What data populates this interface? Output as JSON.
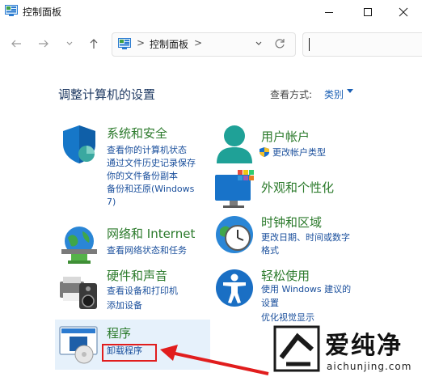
{
  "window": {
    "title": "控制面板",
    "minimize_icon": "minimize-icon",
    "maximize_icon": "maximize-icon",
    "close_icon": "close-icon"
  },
  "nav": {
    "address": "控制面板",
    "separator": ">"
  },
  "main": {
    "heading": "调整计算机的设置",
    "view_by_label": "查看方式:",
    "view_by_value": "类别"
  },
  "categories": {
    "security": {
      "title": "系统和安全",
      "links": [
        "查看你的计算机状态",
        "通过文件历史记录保存",
        "你的文件备份副本",
        "备份和还原(Windows",
        "7)"
      ]
    },
    "network": {
      "title": "网络和 Internet",
      "links": [
        "查看网络状态和任务"
      ]
    },
    "hardware": {
      "title": "硬件和声音",
      "links": [
        "查看设备和打印机",
        "添加设备"
      ]
    },
    "programs": {
      "title": "程序",
      "links": [
        "卸载程序"
      ]
    },
    "users": {
      "title": "用户帐户",
      "links": [
        "更改帐户类型"
      ]
    },
    "appearance": {
      "title": "外观和个性化"
    },
    "clock": {
      "title": "时钟和区域",
      "links": [
        "更改日期、时间或数字",
        "格式"
      ]
    },
    "ease": {
      "title": "轻松使用",
      "links": [
        "使用 Windows 建议的",
        "设置",
        "优化视觉显示"
      ]
    }
  },
  "watermark": {
    "brand": "爱纯净",
    "url": "aichunjing.com"
  }
}
